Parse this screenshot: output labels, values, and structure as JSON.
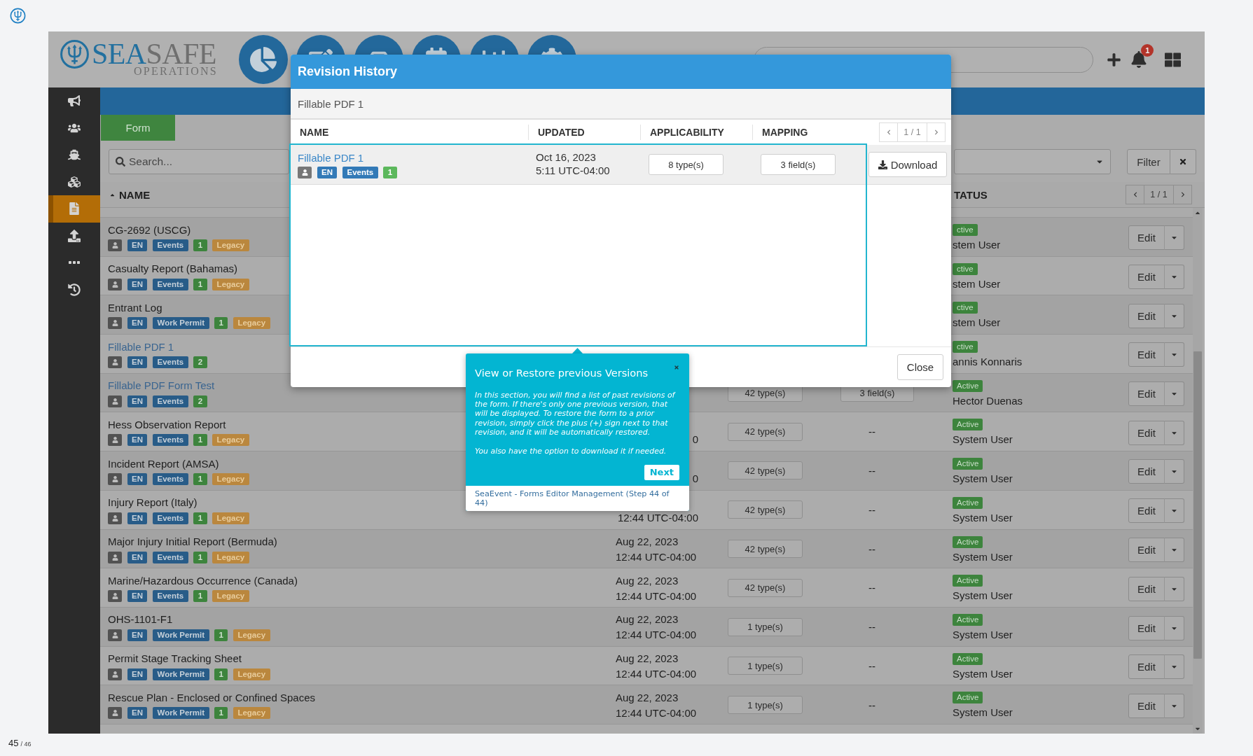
{
  "header": {
    "logo": {
      "lead": "SEA",
      "rest": "SAFE",
      "tagline": "OPERATIONS"
    },
    "notifications": {
      "count": "1"
    }
  },
  "sidebar": {
    "items": [
      {
        "selected": false
      },
      {
        "selected": false
      },
      {
        "selected": false
      },
      {
        "selected": false
      },
      {
        "selected": true
      },
      {
        "selected": false
      },
      {
        "selected": false
      },
      {
        "selected": false
      }
    ]
  },
  "tabs": [
    {
      "label": "Form",
      "selected": true
    }
  ],
  "filters": {
    "search_placeholder": "Search...",
    "filter_button": "Filter"
  },
  "table": {
    "columns": [
      {
        "label": "NAME",
        "sorted": true
      },
      {
        "label": "TATUS",
        "sorted": false
      }
    ],
    "pagination": "1 / 1",
    "rows": [
      {
        "name": "CG-2692 (USCG)",
        "link": false,
        "tags": [
          {
            "kind": "owner"
          },
          {
            "kind": "language",
            "label": "EN"
          },
          {
            "kind": "category",
            "label": "Events"
          },
          {
            "kind": "version",
            "label": "1"
          },
          {
            "kind": "legacy",
            "label": "Legacy"
          }
        ],
        "status": "ctive",
        "user": "stem User",
        "action": "Edit"
      },
      {
        "name": "Casualty Report (Bahamas)",
        "link": false,
        "tags": [
          {
            "kind": "owner"
          },
          {
            "kind": "language",
            "label": "EN"
          },
          {
            "kind": "category",
            "label": "Events"
          },
          {
            "kind": "version",
            "label": "1"
          },
          {
            "kind": "legacy",
            "label": "Legacy"
          }
        ],
        "status": "ctive",
        "user": "stem User",
        "action": "Edit"
      },
      {
        "name": "Entrant Log",
        "link": false,
        "tags": [
          {
            "kind": "owner"
          },
          {
            "kind": "language",
            "label": "EN"
          },
          {
            "kind": "category",
            "label": "Work Permit"
          },
          {
            "kind": "version",
            "label": "1"
          },
          {
            "kind": "legacy",
            "label": "Legacy"
          }
        ],
        "status": "ctive",
        "user": "stem User",
        "action": "Edit"
      },
      {
        "name": "Fillable PDF 1",
        "link": true,
        "tags": [
          {
            "kind": "owner"
          },
          {
            "kind": "language",
            "label": "EN"
          },
          {
            "kind": "category",
            "label": "Events"
          },
          {
            "kind": "version",
            "label": "2"
          }
        ],
        "status": "ctive",
        "user": "annis Konnaris",
        "action": "Edit"
      },
      {
        "name": "Fillable PDF Form Test",
        "link": true,
        "tags": [
          {
            "kind": "owner"
          },
          {
            "kind": "language",
            "label": "EN"
          },
          {
            "kind": "category",
            "label": "Events"
          },
          {
            "kind": "version",
            "label": "2"
          }
        ],
        "applicability": "42 type(s)",
        "mapping": {
          "kind": "button",
          "label": "3 field(s)"
        },
        "status": "Active",
        "user": "Hector Duenas",
        "action": "Edit"
      },
      {
        "name": "Hess Observation Report",
        "link": false,
        "tags": [
          {
            "kind": "owner"
          },
          {
            "kind": "language",
            "label": "EN"
          },
          {
            "kind": "category",
            "label": "Events"
          },
          {
            "kind": "version",
            "label": "1"
          },
          {
            "kind": "legacy",
            "label": "Legacy"
          }
        ],
        "updated": [
          "0"
        ],
        "applicability": "42 type(s)",
        "mapping": {
          "kind": "text",
          "label": "--"
        },
        "status": "Active",
        "user": "System User",
        "action": "Edit"
      },
      {
        "name": "Incident Report (AMSA)",
        "link": false,
        "tags": [
          {
            "kind": "owner"
          },
          {
            "kind": "language",
            "label": "EN"
          },
          {
            "kind": "category",
            "label": "Events"
          },
          {
            "kind": "version",
            "label": "1"
          },
          {
            "kind": "legacy",
            "label": "Legacy"
          }
        ],
        "updated": [
          "0"
        ],
        "applicability": "42 type(s)",
        "mapping": {
          "kind": "text",
          "label": "--"
        },
        "status": "Active",
        "user": "System User",
        "action": "Edit"
      },
      {
        "name": "Injury Report (Italy)",
        "link": false,
        "tags": [
          {
            "kind": "owner"
          },
          {
            "kind": "language",
            "label": "EN"
          },
          {
            "kind": "category",
            "label": "Events"
          },
          {
            "kind": "version",
            "label": "1"
          },
          {
            "kind": "legacy",
            "label": "Legacy"
          }
        ],
        "updated": [
          "12:44 UTC-04:00"
        ],
        "applicability": "42 type(s)",
        "mapping": {
          "kind": "text",
          "label": "--"
        },
        "status": "Active",
        "user": "System User",
        "action": "Edit"
      },
      {
        "name": "Major Injury Initial Report (Bermuda)",
        "link": false,
        "tags": [
          {
            "kind": "owner"
          },
          {
            "kind": "language",
            "label": "EN"
          },
          {
            "kind": "category",
            "label": "Events"
          },
          {
            "kind": "version",
            "label": "1"
          },
          {
            "kind": "legacy",
            "label": "Legacy"
          }
        ],
        "updated": [
          "Aug 22, 2023",
          "12:44 UTC-04:00"
        ],
        "applicability": "42 type(s)",
        "mapping": {
          "kind": "text",
          "label": "--"
        },
        "status": "Active",
        "user": "System User",
        "action": "Edit"
      },
      {
        "name": "Marine/Hazardous Occurrence (Canada)",
        "link": false,
        "tags": [
          {
            "kind": "owner"
          },
          {
            "kind": "language",
            "label": "EN"
          },
          {
            "kind": "category",
            "label": "Events"
          },
          {
            "kind": "version",
            "label": "1"
          },
          {
            "kind": "legacy",
            "label": "Legacy"
          }
        ],
        "updated": [
          "Aug 22, 2023",
          "12:44 UTC-04:00"
        ],
        "applicability": "42 type(s)",
        "mapping": {
          "kind": "text",
          "label": "--"
        },
        "status": "Active",
        "user": "System User",
        "action": "Edit"
      },
      {
        "name": "OHS-1101-F1",
        "link": false,
        "tags": [
          {
            "kind": "owner"
          },
          {
            "kind": "language",
            "label": "EN"
          },
          {
            "kind": "category",
            "label": "Work Permit"
          },
          {
            "kind": "version",
            "label": "1"
          },
          {
            "kind": "legacy",
            "label": "Legacy"
          }
        ],
        "updated": [
          "Aug 22, 2023",
          "12:44 UTC-04:00"
        ],
        "applicability": "1 type(s)",
        "mapping": {
          "kind": "text",
          "label": "--"
        },
        "status": "Active",
        "user": "System User",
        "action": "Edit"
      },
      {
        "name": "Permit Stage Tracking Sheet",
        "link": false,
        "tags": [
          {
            "kind": "owner"
          },
          {
            "kind": "language",
            "label": "EN"
          },
          {
            "kind": "category",
            "label": "Work Permit"
          },
          {
            "kind": "version",
            "label": "1"
          },
          {
            "kind": "legacy",
            "label": "Legacy"
          }
        ],
        "updated": [
          "Aug 22, 2023",
          "12:44 UTC-04:00"
        ],
        "applicability": "1 type(s)",
        "mapping": {
          "kind": "text",
          "label": "--"
        },
        "status": "Active",
        "user": "System User",
        "action": "Edit"
      },
      {
        "name": "Rescue Plan - Enclosed or Confined Spaces",
        "link": false,
        "tags": [
          {
            "kind": "owner"
          },
          {
            "kind": "language",
            "label": "EN"
          },
          {
            "kind": "category",
            "label": "Work Permit"
          },
          {
            "kind": "version",
            "label": "1"
          },
          {
            "kind": "legacy",
            "label": "Legacy"
          }
        ],
        "updated": [
          "Aug 22, 2023",
          "12:44 UTC-04:00"
        ],
        "applicability": "1 type(s)",
        "mapping": {
          "kind": "text",
          "label": "--"
        },
        "status": "Active",
        "user": "System User",
        "action": "Edit"
      }
    ]
  },
  "revision_modal": {
    "title": "Revision History",
    "form_name": "Fillable PDF 1",
    "columns": [
      "NAME",
      "UPDATED",
      "APPLICABILITY",
      "MAPPING"
    ],
    "pagination": "1 / 1",
    "rows": [
      {
        "name": "Fillable PDF 1",
        "tags": [
          {
            "kind": "owner"
          },
          {
            "kind": "language",
            "label": "EN"
          },
          {
            "kind": "category",
            "label": "Events"
          },
          {
            "kind": "version",
            "label": "1"
          }
        ],
        "updated": [
          "Oct 16, 2023",
          "5:11 UTC-04:00"
        ],
        "applicability": "8 type(s)",
        "mapping": "3 field(s)",
        "action": "Download"
      }
    ],
    "close_button": "Close"
  },
  "tour": {
    "title": "View or Restore previous Versions",
    "paragraphs": [
      "In this section, you will find a list of past revisions of the form. If there's only one previous version, that will be displayed. To restore the form to a prior revision, simply click the plus (+) sign next to that revision, and it will be automatically restored.",
      "You also have the option to download it if needed."
    ],
    "next_button": "Next",
    "footer": "SeaEvent - Forms Editor Management (Step 44 of 44)"
  },
  "page_counter": {
    "current": "45",
    "total": "/ 46"
  }
}
